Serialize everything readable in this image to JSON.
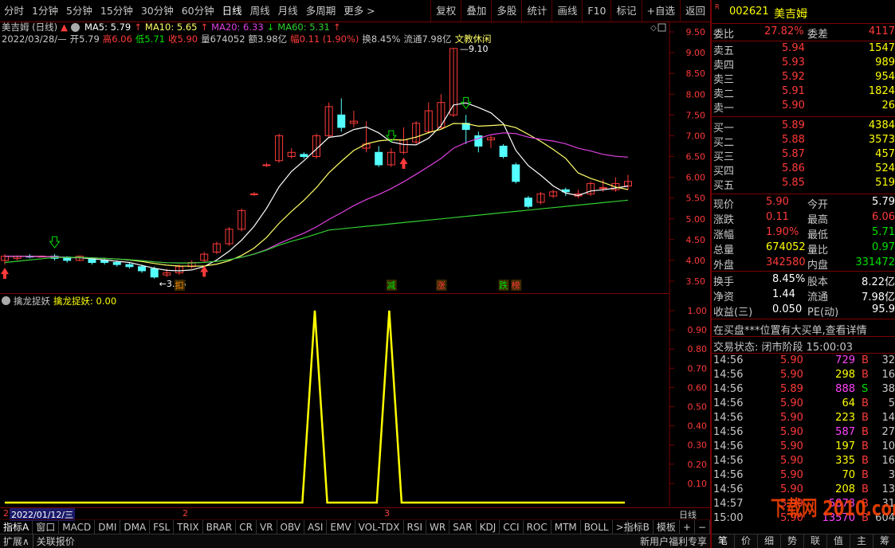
{
  "toolbar": {
    "tabs": [
      "分时",
      "1分钟",
      "5分钟",
      "15分钟",
      "30分钟",
      "60分钟",
      "日线",
      "周线",
      "月线",
      "多周期",
      "更多 >"
    ],
    "active_tab": "日线",
    "tools": [
      "复权",
      "叠加",
      "多股",
      "统计",
      "画线",
      "F10",
      "标记",
      "+自选",
      "返回"
    ]
  },
  "info": {
    "name": "美吉姆 (日线)",
    "ma5": "MA5: 5.79",
    "ma10": "MA10: 5.65",
    "ma20": "MA20: 6.33",
    "ma60": "MA60: 5.31",
    "date": "2022/03/28/—",
    "open": "开5.79",
    "high": "高6.06",
    "low": "低5.71",
    "close": "收5.90",
    "volume": "量674052",
    "amount": "额3.98亿",
    "change": "幅0.11 (1.90%)",
    "turnover": "换8.45%",
    "float": "流通7.98亿",
    "sector": "文教休闲"
  },
  "chart": {
    "price_ticks": [
      "9.50",
      "9.00",
      "8.50",
      "8.00",
      "7.50",
      "7.00",
      "6.50",
      "6.00",
      "5.50",
      "5.00",
      "4.50",
      "4.00",
      "3.50"
    ],
    "max_label": "9.10",
    "min_label": "3.56",
    "markers": [
      "扣",
      "减",
      "涨",
      "跌",
      "榜"
    ],
    "colors": {
      "up": "#ff3a3a",
      "down": "#54ffff",
      "ma5": "#ffffff",
      "ma10": "#ffff66",
      "ma20": "#e040e0",
      "ma60": "#30d030",
      "grid": "#7a0000"
    }
  },
  "chart_data": {
    "type": "line",
    "title": "擒龙捉妖",
    "series": [
      {
        "name": "擒龙捉妖",
        "values": [
          0,
          0,
          0,
          0,
          0,
          0,
          0,
          0,
          0,
          0,
          0,
          0,
          0,
          0,
          0,
          0,
          0,
          0,
          0,
          0,
          0,
          0,
          0,
          0,
          0,
          1,
          0,
          0,
          0,
          0,
          0,
          1,
          0,
          0,
          0,
          0,
          0,
          0,
          0,
          0,
          0,
          0,
          0,
          0,
          0,
          0,
          0,
          0,
          0,
          0,
          0
        ]
      }
    ],
    "ylim": [
      0,
      1.0
    ],
    "y_ticks": [
      "1.00",
      "0.90",
      "0.80",
      "0.70",
      "0.60",
      "0.50",
      "0.40",
      "0.30",
      "0.20",
      "0.10"
    ]
  },
  "sub": {
    "title": "擒龙捉妖",
    "value_label": "擒龙捉妖: 0.00"
  },
  "datebar": {
    "start_num": "2",
    "date": "2022/01/12/三",
    "mid1": "2",
    "mid2": "3",
    "right_label": "日线"
  },
  "indicators": [
    "指标A",
    "窗口",
    "MACD",
    "DMI",
    "DMA",
    "FSL",
    "TRIX",
    "BRAR",
    "CR",
    "VR",
    "OBV",
    "ASI",
    "EMV",
    "VOL-TDX",
    "RSI",
    "WR",
    "SAR",
    "KDJ",
    "CCI",
    "ROC",
    "MTM",
    "BOLL",
    ">"
  ],
  "indicators_right": [
    "指标B",
    "模板",
    "+",
    "−"
  ],
  "status": {
    "left1": "扩展∧",
    "left2": "关联报价",
    "right": "新用户福利专享"
  },
  "quote": {
    "code": "002621",
    "name": "美吉姆",
    "weibi_label": "委比",
    "weibi": "27.82%",
    "weicha_label": "委差",
    "weicha": "4117",
    "asks": [
      {
        "label": "卖五",
        "price": "5.94",
        "vol": "1547"
      },
      {
        "label": "卖四",
        "price": "5.93",
        "vol": "989"
      },
      {
        "label": "卖三",
        "price": "5.92",
        "vol": "954"
      },
      {
        "label": "卖二",
        "price": "5.91",
        "vol": "1824"
      },
      {
        "label": "卖一",
        "price": "5.90",
        "vol": "26"
      }
    ],
    "bids": [
      {
        "label": "买一",
        "price": "5.89",
        "vol": "4384"
      },
      {
        "label": "买二",
        "price": "5.88",
        "vol": "3573"
      },
      {
        "label": "买三",
        "price": "5.87",
        "vol": "457"
      },
      {
        "label": "买四",
        "price": "5.86",
        "vol": "524"
      },
      {
        "label": "买五",
        "price": "5.85",
        "vol": "519"
      }
    ],
    "stats": [
      {
        "l1": "现价",
        "v1": "5.90",
        "c1": "red",
        "l2": "今开",
        "v2": "5.79",
        "c2": "white"
      },
      {
        "l1": "涨跌",
        "v1": "0.11",
        "c1": "red",
        "l2": "最高",
        "v2": "6.06",
        "c2": "red"
      },
      {
        "l1": "涨幅",
        "v1": "1.90%",
        "c1": "red",
        "l2": "最低",
        "v2": "5.71",
        "c2": "green"
      },
      {
        "l1": "总量",
        "v1": "674052",
        "c1": "yellow",
        "l2": "量比",
        "v2": "0.97",
        "c2": "green"
      },
      {
        "l1": "外盘",
        "v1": "342580",
        "c1": "red",
        "l2": "内盘",
        "v2": "331472",
        "c2": "green"
      }
    ],
    "stats2": [
      {
        "l1": "换手",
        "v1": "8.45%",
        "l2": "股本",
        "v2": "8.22亿"
      },
      {
        "l1": "净资",
        "v1": "1.44",
        "l2": "流通",
        "v2": "7.98亿"
      },
      {
        "l1": "收益(三)",
        "v1": "0.050",
        "l2": "PE(动)",
        "v2": "95.9"
      }
    ],
    "notice": "在买盘***位置有大买单,查看详情",
    "trade_state": "交易状态: 闭市阶段 15:00:03",
    "ticks": [
      {
        "t": "14:56",
        "p": "5.90",
        "v": "729",
        "vc": "magenta",
        "s": "B",
        "n": "32"
      },
      {
        "t": "14:56",
        "p": "5.90",
        "v": "298",
        "vc": "yellow",
        "s": "B",
        "n": "16"
      },
      {
        "t": "14:56",
        "p": "5.89",
        "v": "888",
        "vc": "magenta",
        "s": "S",
        "n": "38"
      },
      {
        "t": "14:56",
        "p": "5.90",
        "v": "64",
        "vc": "yellow",
        "s": "B",
        "n": "5"
      },
      {
        "t": "14:56",
        "p": "5.90",
        "v": "223",
        "vc": "yellow",
        "s": "B",
        "n": "14"
      },
      {
        "t": "14:56",
        "p": "5.90",
        "v": "587",
        "vc": "magenta",
        "s": "B",
        "n": "27"
      },
      {
        "t": "14:56",
        "p": "5.90",
        "v": "197",
        "vc": "yellow",
        "s": "B",
        "n": "10"
      },
      {
        "t": "14:56",
        "p": "5.90",
        "v": "335",
        "vc": "yellow",
        "s": "B",
        "n": "16"
      },
      {
        "t": "14:56",
        "p": "5.90",
        "v": "70",
        "vc": "yellow",
        "s": "B",
        "n": "3"
      },
      {
        "t": "14:56",
        "p": "5.90",
        "v": "208",
        "vc": "yellow",
        "s": "B",
        "n": "13"
      },
      {
        "t": "14:57",
        "p": "5.90",
        "v": "5873",
        "vc": "magenta",
        "s": "B",
        "n": "31"
      },
      {
        "t": "15:00",
        "p": "5.90",
        "v": "13570",
        "vc": "magenta",
        "s": "B",
        "n": "604"
      }
    ],
    "bottom_tabs": [
      "笔",
      "价",
      "细",
      "势",
      "联",
      "值",
      "主",
      "筹"
    ],
    "watermark": "下载网 2010.com"
  }
}
